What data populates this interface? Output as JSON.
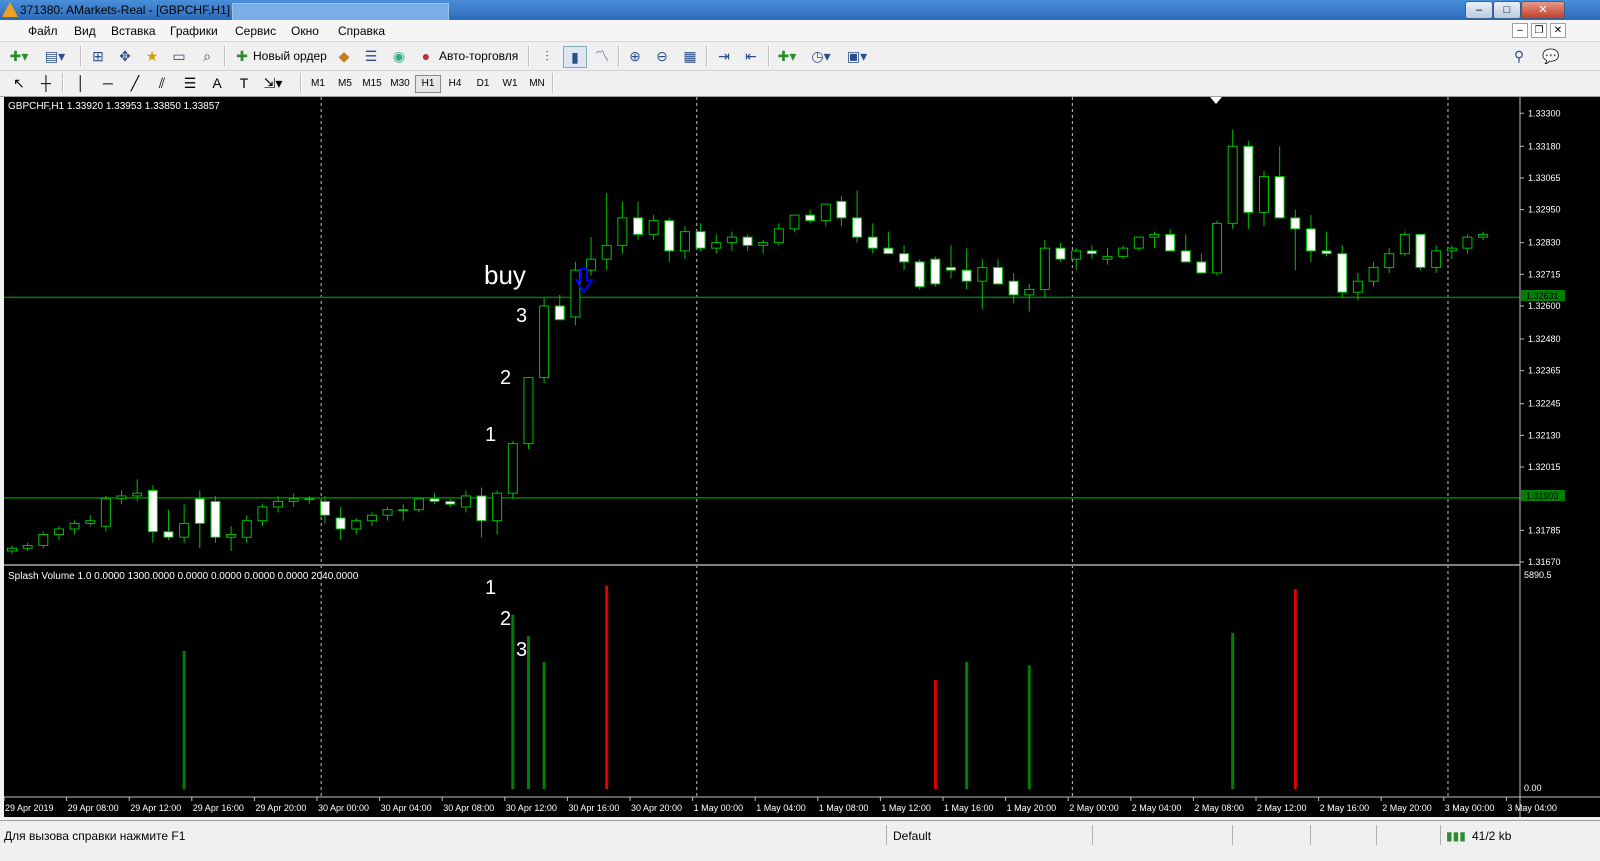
{
  "window": {
    "title": "371380: AMarkets-Real - [GBPCHF,H1]",
    "buttons": [
      "–",
      "□",
      "✕"
    ]
  },
  "menu": {
    "items": [
      "Файл",
      "Вид",
      "Вставка",
      "Графики",
      "Сервис",
      "Окно",
      "Справка"
    ]
  },
  "toolbar": {
    "new_order_label": "Новый ордер",
    "autotrading_label": "Авто-торговля",
    "timeframes": [
      "M1",
      "M5",
      "M15",
      "M30",
      "H1",
      "H4",
      "D1",
      "W1",
      "MN"
    ],
    "active_timeframe": "H1",
    "icons": [
      "new-chart-icon",
      "profiles-icon",
      "market-watch-icon",
      "navigator-icon",
      "data-window-icon",
      "terminal-icon",
      "strategy-tester-icon",
      "new-order-icon",
      "metaeditor-icon",
      "autotrading-icon",
      "bar-chart-icon",
      "candlestick-icon",
      "line-chart-icon",
      "zoom-in-icon",
      "zoom-out-icon",
      "tile-icon",
      "auto-scroll-icon",
      "chart-shift-icon",
      "indicators-icon",
      "periods-icon",
      "templates-icon",
      "search-icon",
      "chat-icon"
    ],
    "drawing_tools": [
      "cursor-icon",
      "crosshair-icon",
      "vertical-line-icon",
      "horizontal-line-icon",
      "trendline-icon",
      "channel-icon",
      "fibonacci-icon",
      "text-icon",
      "text-label-icon",
      "arrow-icon"
    ]
  },
  "chart": {
    "symbol_info": "GBPCHF,H1  1.33920 1.33953 1.33850 1.33857",
    "indicator_info": "Splash Volume 1.0 0.0000 1300.0000 0.0000 0.0000 0.0000 0.0000 2040.0000",
    "annotations": {
      "buy": "buy",
      "price_labels": [
        "1",
        "2",
        "3"
      ],
      "volume_labels": [
        "1",
        "2",
        "3"
      ]
    },
    "price_axis": [
      "1.33300",
      "1.33180",
      "1.33065",
      "1.32950",
      "1.32830",
      "1.32715",
      "1.32600",
      "1.32480",
      "1.32365",
      "1.32245",
      "1.32130",
      "1.32015",
      "1.31785",
      "1.31670"
    ],
    "hline_labels": [
      "1.32631",
      "1.31903"
    ],
    "volume_axis": [
      "5890.5",
      "0.00"
    ],
    "time_axis": [
      "29 Apr 2019",
      "29 Apr 08:00",
      "29 Apr 12:00",
      "29 Apr 16:00",
      "29 Apr 20:00",
      "30 Apr 00:00",
      "30 Apr 04:00",
      "30 Apr 08:00",
      "30 Apr 12:00",
      "30 Apr 16:00",
      "30 Apr 20:00",
      "1 May 00:00",
      "1 May 04:00",
      "1 May 08:00",
      "1 May 12:00",
      "1 May 16:00",
      "1 May 20:00",
      "2 May 00:00",
      "2 May 04:00",
      "2 May 08:00",
      "2 May 12:00",
      "2 May 16:00",
      "2 May 20:00",
      "3 May 00:00",
      "3 May 04:00"
    ],
    "colors": {
      "background": "#000000",
      "bull_candle": "#000000",
      "bear_candle": "#ffffff",
      "wick": "#00c000",
      "hline": "#008000",
      "volume_green": "#008000",
      "volume_red": "#e00000",
      "arrow": "#0000ff"
    }
  },
  "chart_data": {
    "type": "candlestick",
    "candles": [
      [
        1.3171,
        1.3173,
        1.317,
        1.3172
      ],
      [
        1.3172,
        1.3174,
        1.3171,
        1.3173
      ],
      [
        1.3173,
        1.3178,
        1.3172,
        1.3177
      ],
      [
        1.3177,
        1.318,
        1.3175,
        1.3179
      ],
      [
        1.3179,
        1.3182,
        1.3177,
        1.3181
      ],
      [
        1.3181,
        1.3184,
        1.318,
        1.3182
      ],
      [
        1.318,
        1.3191,
        1.3178,
        1.319
      ],
      [
        1.319,
        1.3193,
        1.3188,
        1.3191
      ],
      [
        1.3191,
        1.3197,
        1.3189,
        1.3192
      ],
      [
        1.3193,
        1.3195,
        1.3174,
        1.3178
      ],
      [
        1.3178,
        1.3186,
        1.3175,
        1.3176
      ],
      [
        1.3176,
        1.3188,
        1.3174,
        1.3181
      ],
      [
        1.319,
        1.3193,
        1.3172,
        1.3181
      ],
      [
        1.3189,
        1.3191,
        1.3174,
        1.3176
      ],
      [
        1.3176,
        1.318,
        1.3171,
        1.3177
      ],
      [
        1.3176,
        1.3184,
        1.3174,
        1.3182
      ],
      [
        1.3182,
        1.3188,
        1.318,
        1.3187
      ],
      [
        1.3187,
        1.3191,
        1.3185,
        1.3189
      ],
      [
        1.3189,
        1.3192,
        1.3187,
        1.319
      ],
      [
        1.319,
        1.3191,
        1.3188,
        1.319
      ],
      [
        1.3189,
        1.3191,
        1.3181,
        1.3184
      ],
      [
        1.3183,
        1.3187,
        1.3175,
        1.3179
      ],
      [
        1.3179,
        1.3183,
        1.3177,
        1.3182
      ],
      [
        1.3182,
        1.3185,
        1.318,
        1.3184
      ],
      [
        1.3184,
        1.3187,
        1.3182,
        1.3186
      ],
      [
        1.3186,
        1.3188,
        1.3182,
        1.3186
      ],
      [
        1.3186,
        1.319,
        1.3185,
        1.319
      ],
      [
        1.319,
        1.3192,
        1.3188,
        1.3189
      ],
      [
        1.3189,
        1.319,
        1.3187,
        1.3188
      ],
      [
        1.3187,
        1.3193,
        1.3185,
        1.3191
      ],
      [
        1.3191,
        1.3194,
        1.3176,
        1.3182
      ],
      [
        1.3182,
        1.3193,
        1.3177,
        1.3192
      ],
      [
        1.3192,
        1.3211,
        1.319,
        1.321
      ],
      [
        1.321,
        1.3234,
        1.3208,
        1.3234
      ],
      [
        1.3234,
        1.3263,
        1.3232,
        1.326
      ],
      [
        1.326,
        1.3264,
        1.3256,
        1.3255
      ],
      [
        1.3256,
        1.3276,
        1.3253,
        1.3273
      ],
      [
        1.3273,
        1.3285,
        1.3271,
        1.3277
      ],
      [
        1.3277,
        1.3301,
        1.3273,
        1.3282
      ],
      [
        1.3282,
        1.3298,
        1.3279,
        1.3292
      ],
      [
        1.3292,
        1.3298,
        1.3284,
        1.3286
      ],
      [
        1.3286,
        1.3293,
        1.3284,
        1.3291
      ],
      [
        1.3291,
        1.3292,
        1.3276,
        1.328
      ],
      [
        1.328,
        1.3289,
        1.3277,
        1.3287
      ],
      [
        1.3287,
        1.329,
        1.328,
        1.3281
      ],
      [
        1.3281,
        1.3286,
        1.3279,
        1.3283
      ],
      [
        1.3283,
        1.3287,
        1.328,
        1.3285
      ],
      [
        1.3285,
        1.3286,
        1.328,
        1.3282
      ],
      [
        1.3282,
        1.3284,
        1.3279,
        1.3283
      ],
      [
        1.3283,
        1.329,
        1.3282,
        1.3288
      ],
      [
        1.3288,
        1.3293,
        1.3287,
        1.3293
      ],
      [
        1.3293,
        1.3295,
        1.329,
        1.3291
      ],
      [
        1.3291,
        1.3297,
        1.3289,
        1.3297
      ],
      [
        1.3298,
        1.33,
        1.3289,
        1.3292
      ],
      [
        1.3292,
        1.3302,
        1.3283,
        1.3285
      ],
      [
        1.3285,
        1.329,
        1.3279,
        1.3281
      ],
      [
        1.3281,
        1.3287,
        1.3279,
        1.3279
      ],
      [
        1.3279,
        1.3282,
        1.3273,
        1.3276
      ],
      [
        1.3276,
        1.3277,
        1.3266,
        1.3267
      ],
      [
        1.3277,
        1.3278,
        1.3267,
        1.3268
      ],
      [
        1.3274,
        1.3282,
        1.327,
        1.3273
      ],
      [
        1.3273,
        1.3281,
        1.3266,
        1.3269
      ],
      [
        1.3269,
        1.3277,
        1.3259,
        1.3274
      ],
      [
        1.3274,
        1.3277,
        1.3268,
        1.3268
      ],
      [
        1.3269,
        1.3272,
        1.3261,
        1.3264
      ],
      [
        1.3264,
        1.3268,
        1.3258,
        1.3266
      ],
      [
        1.3266,
        1.3284,
        1.3263,
        1.3281
      ],
      [
        1.3281,
        1.3283,
        1.3276,
        1.3277
      ],
      [
        1.3277,
        1.3281,
        1.3273,
        1.328
      ],
      [
        1.328,
        1.3282,
        1.3277,
        1.3279
      ],
      [
        1.3277,
        1.3281,
        1.3275,
        1.3278
      ],
      [
        1.3278,
        1.3282,
        1.3277,
        1.3281
      ],
      [
        1.3281,
        1.3284,
        1.328,
        1.3285
      ],
      [
        1.3285,
        1.3287,
        1.3281,
        1.3286
      ],
      [
        1.3286,
        1.3288,
        1.3283,
        1.328
      ],
      [
        1.328,
        1.3286,
        1.3278,
        1.3276
      ],
      [
        1.3276,
        1.3279,
        1.3272,
        1.3272
      ],
      [
        1.3272,
        1.3291,
        1.3271,
        1.329
      ],
      [
        1.329,
        1.3324,
        1.3288,
        1.3318
      ],
      [
        1.3318,
        1.332,
        1.3288,
        1.3294
      ],
      [
        1.3294,
        1.3309,
        1.3289,
        1.3307
      ],
      [
        1.3307,
        1.3318,
        1.3292,
        1.3292
      ],
      [
        1.3292,
        1.3295,
        1.3273,
        1.3288
      ],
      [
        1.3288,
        1.3293,
        1.3276,
        1.328
      ],
      [
        1.328,
        1.3287,
        1.3278,
        1.3279
      ],
      [
        1.3279,
        1.3282,
        1.3263,
        1.3265
      ],
      [
        1.3265,
        1.3272,
        1.3262,
        1.3269
      ],
      [
        1.3269,
        1.3276,
        1.3267,
        1.3274
      ],
      [
        1.3274,
        1.3281,
        1.3272,
        1.3279
      ],
      [
        1.3279,
        1.3287,
        1.3278,
        1.3286
      ],
      [
        1.3286,
        1.3286,
        1.3273,
        1.3274
      ],
      [
        1.3274,
        1.3282,
        1.3272,
        1.328
      ],
      [
        1.328,
        1.3282,
        1.3277,
        1.3281
      ],
      [
        1.3281,
        1.3286,
        1.3279,
        1.3285
      ],
      [
        1.3285,
        1.3287,
        1.3284,
        1.3286
      ]
    ],
    "volume_bars": [
      {
        "index": 11,
        "value": 3800,
        "color": "green"
      },
      {
        "index": 32,
        "value": 4800,
        "color": "green"
      },
      {
        "index": 33,
        "value": 4200,
        "color": "green"
      },
      {
        "index": 34,
        "value": 3500,
        "color": "green"
      },
      {
        "index": 38,
        "value": 5600,
        "color": "red"
      },
      {
        "index": 59,
        "value": 3000,
        "color": "red"
      },
      {
        "index": 61,
        "value": 3500,
        "color": "green"
      },
      {
        "index": 65,
        "value": 3400,
        "color": "green"
      },
      {
        "index": 78,
        "value": 4300,
        "color": "green"
      },
      {
        "index": 82,
        "value": 5500,
        "color": "red"
      }
    ],
    "hlines": [
      1.32631,
      1.31903
    ],
    "ylim": [
      1.3167,
      1.3333
    ],
    "vol_ylim": [
      0,
      5890.5
    ]
  },
  "status": {
    "help": "Для вызова справки нажмите F1",
    "profile": "Default",
    "traffic": "41/2 kb"
  }
}
